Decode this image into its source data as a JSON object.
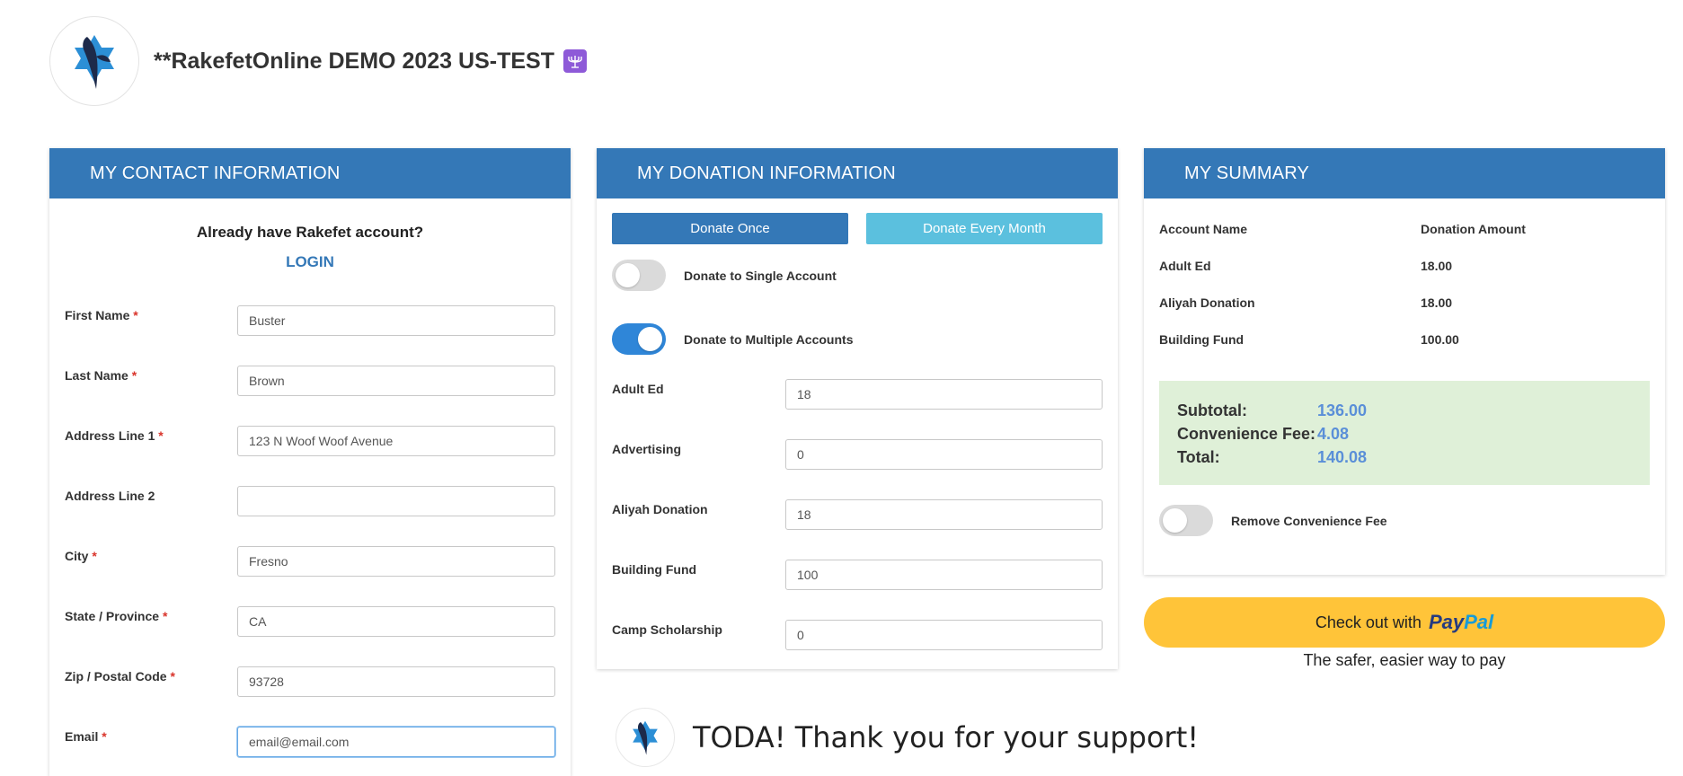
{
  "header": {
    "title": "**RakefetOnline DEMO 2023 US-TEST",
    "logo_icon": "star-of-david-leaf-logo",
    "title_icon": "menorah-icon"
  },
  "contact": {
    "heading": "MY CONTACT INFORMATION",
    "account_question": "Already have Rakefet account?",
    "login_label": "LOGIN",
    "required_mark": "*",
    "fields": [
      {
        "label": "First Name",
        "required": true,
        "value": "Buster"
      },
      {
        "label": "Last Name",
        "required": true,
        "value": "Brown"
      },
      {
        "label": "Address Line 1",
        "required": true,
        "value": "123 N Woof Woof Avenue"
      },
      {
        "label": "Address Line 2",
        "required": false,
        "value": ""
      },
      {
        "label": "City",
        "required": true,
        "value": "Fresno"
      },
      {
        "label": "State / Province",
        "required": true,
        "value": "CA"
      },
      {
        "label": "Zip / Postal Code",
        "required": true,
        "value": "93728"
      },
      {
        "label": "Email",
        "required": true,
        "value": "email@email.com"
      }
    ]
  },
  "donation": {
    "heading": "MY DONATION INFORMATION",
    "donate_once_label": "Donate Once",
    "donate_monthly_label": "Donate Every Month",
    "single_account_label": "Donate to Single Account",
    "single_account_on": false,
    "multiple_accounts_label": "Donate to Multiple Accounts",
    "multiple_accounts_on": true,
    "accounts": [
      {
        "label": "Adult Ed",
        "value": "18"
      },
      {
        "label": "Advertising",
        "value": "0"
      },
      {
        "label": "Aliyah Donation",
        "value": "18"
      },
      {
        "label": "Building Fund",
        "value": "100"
      },
      {
        "label": "Camp Scholarship",
        "value": "0"
      }
    ]
  },
  "summary": {
    "heading": "MY SUMMARY",
    "col_account": "Account Name",
    "col_amount": "Donation Amount",
    "rows": [
      {
        "account": "Adult Ed",
        "amount": "18.00"
      },
      {
        "account": "Aliyah Donation",
        "amount": "18.00"
      },
      {
        "account": "Building Fund",
        "amount": "100.00"
      }
    ],
    "subtotal_label": "Subtotal:",
    "subtotal_value": "136.00",
    "fee_label": "Convenience Fee:",
    "fee_value": "4.08",
    "total_label": "Total:",
    "total_value": "140.08",
    "remove_fee_label": "Remove Convenience Fee",
    "remove_fee_on": false,
    "colors": {
      "totals_bg": "#dff0d8",
      "amount_text": "#5a8fd8"
    }
  },
  "paypal": {
    "button_prefix": "Check out with",
    "brand_part1": "Pay",
    "brand_part2": "Pal",
    "tagline": "The safer, easier way to pay"
  },
  "thanks": {
    "message": "TODA! Thank you for your support!"
  },
  "theme": {
    "panel_header": "#3478b7",
    "primary_button": "#3478b7",
    "secondary_button": "#5bc0de",
    "toggle_on": "#2f86d8",
    "paypal_yellow": "#ffc439"
  }
}
